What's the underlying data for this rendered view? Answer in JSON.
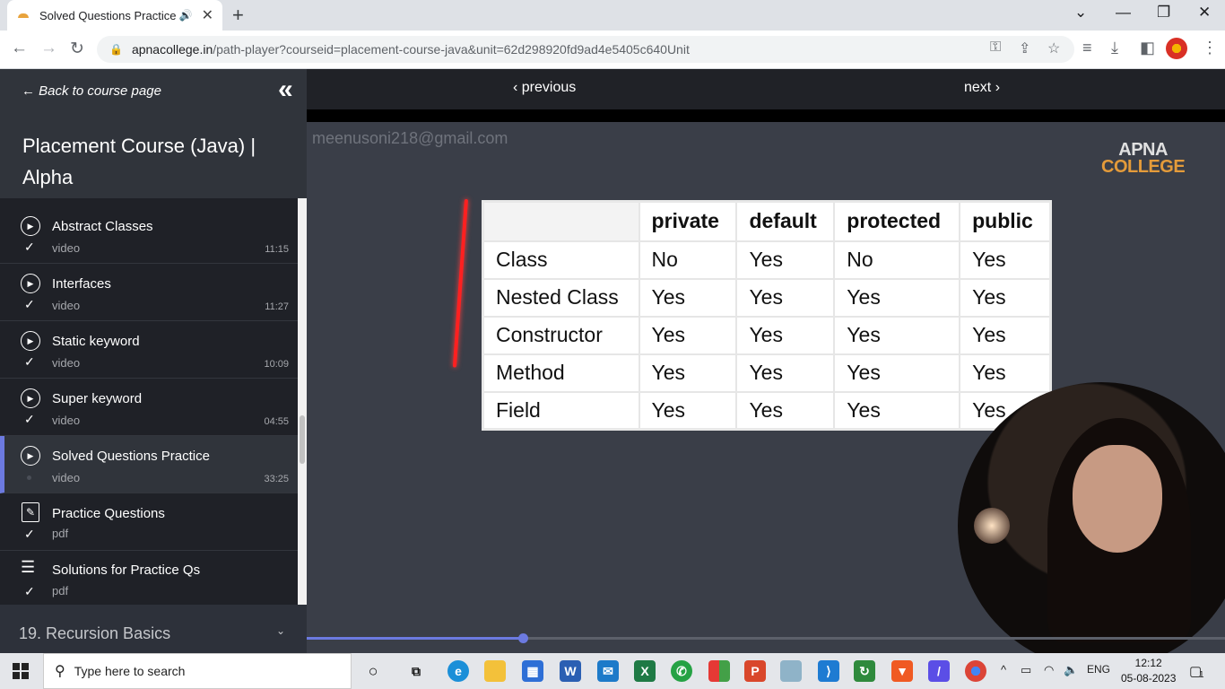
{
  "browser": {
    "tab_title": "Solved Questions Practice",
    "url_host": "apnacollege.in",
    "url_path": "/path-player?courseid=placement-course-java&unit=62d298920fd9ad4e5405c640Unit",
    "new_tab_label": "+",
    "min_label": "—",
    "restore_label": "❐",
    "close_label": "✕",
    "tab_list_label": "⌄"
  },
  "sidebar": {
    "back_label": "← Back to course page",
    "course_title": "Placement Course (Java) | Alpha",
    "items": [
      {
        "name": "Abstract Classes",
        "type": "video",
        "duration": "11:15",
        "icon": "play-circle-icon",
        "done": true
      },
      {
        "name": "Interfaces",
        "type": "video",
        "duration": "11:27",
        "icon": "play-circle-icon",
        "done": true
      },
      {
        "name": "Static keyword",
        "type": "video",
        "duration": "10:09",
        "icon": "play-circle-icon",
        "done": true
      },
      {
        "name": "Super keyword",
        "type": "video",
        "duration": "04:55",
        "icon": "play-circle-icon",
        "done": true
      },
      {
        "name": "Solved Questions Practice",
        "type": "video",
        "duration": "33:25",
        "icon": "play-circle-icon",
        "done": false,
        "active": true
      },
      {
        "name": "Practice Questions",
        "type": "pdf",
        "duration": "",
        "icon": "edit-document-icon",
        "done": true
      },
      {
        "name": "Solutions for Practice Qs",
        "type": "pdf",
        "duration": "",
        "icon": "checklist-icon",
        "done": true
      }
    ],
    "section_label": "19. Recursion Basics"
  },
  "player": {
    "prev_label": "‹ previous",
    "next_label": "next ›",
    "watermark": "meenusoni218@gmail.com",
    "logo_line1": "APNA",
    "logo_line2": "COLLEGE",
    "progress_fraction": 0.235,
    "table": {
      "headers": [
        "",
        "private",
        "default",
        "protected",
        "public"
      ],
      "rows": [
        [
          "Class",
          "No",
          "Yes",
          "No",
          "Yes"
        ],
        [
          "Nested Class",
          "Yes",
          "Yes",
          "Yes",
          "Yes"
        ],
        [
          "Constructor",
          "Yes",
          "Yes",
          "Yes",
          "Yes"
        ],
        [
          "Method",
          "Yes",
          "Yes",
          "Yes",
          "Yes"
        ],
        [
          "Field",
          "Yes",
          "Yes",
          "Yes",
          "Yes"
        ]
      ]
    }
  },
  "taskbar": {
    "search_placeholder": "Type here to search",
    "lang": "ENG",
    "time": "12:12",
    "date": "05-08-2023",
    "notif_count": "1"
  },
  "colors": {
    "accent": "#6c7ae0",
    "sidebar_bg": "#1f2127",
    "video_bg": "#3a3e48"
  }
}
